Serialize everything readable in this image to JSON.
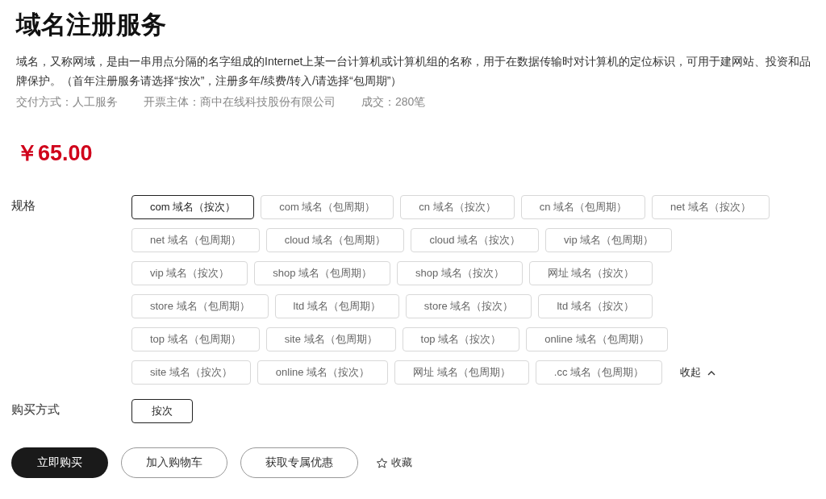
{
  "title": "域名注册服务",
  "description": "域名，又称网域，是由一串用点分隔的名字组成的Internet上某一台计算机或计算机组的名称，用于在数据传输时对计算机的定位标识，可用于建网站、投资和品牌保护。（首年注册服务请选择“按次”，注册多年/续费/转入/请选择“包周期”）",
  "meta": [
    "交付方式：人工服务",
    "开票主体：商中在线科技股份有限公司",
    "成交：280笔"
  ],
  "price": "￥65.00",
  "spec": {
    "label": "规格",
    "collapse_label": "收起",
    "rows": [
      [
        {
          "label": "com 域名（按次）",
          "selected": true
        },
        {
          "label": "com 域名（包周期）",
          "selected": false
        },
        {
          "label": "cn 域名（按次）",
          "selected": false
        },
        {
          "label": "cn 域名（包周期）",
          "selected": false
        },
        {
          "label": "net 域名（按次）",
          "selected": false
        }
      ],
      [
        {
          "label": "net 域名（包周期）",
          "selected": false
        },
        {
          "label": "cloud 域名（包周期）",
          "selected": false
        },
        {
          "label": "cloud 域名（按次）",
          "selected": false
        },
        {
          "label": "vip 域名（包周期）",
          "selected": false
        }
      ],
      [
        {
          "label": "vip 域名（按次）",
          "selected": false
        },
        {
          "label": "shop 域名（包周期）",
          "selected": false
        },
        {
          "label": "shop 域名（按次）",
          "selected": false
        },
        {
          "label": "网址 域名（按次）",
          "selected": false
        }
      ],
      [
        {
          "label": "store 域名（包周期）",
          "selected": false
        },
        {
          "label": "ltd 域名（包周期）",
          "selected": false
        },
        {
          "label": "store 域名（按次）",
          "selected": false
        },
        {
          "label": "ltd 域名（按次）",
          "selected": false
        }
      ],
      [
        {
          "label": "top 域名（包周期）",
          "selected": false
        },
        {
          "label": "site 域名（包周期）",
          "selected": false
        },
        {
          "label": "top 域名（按次）",
          "selected": false
        },
        {
          "label": "online 域名（包周期）",
          "selected": false
        }
      ],
      [
        {
          "label": "site 域名（按次）",
          "selected": false
        },
        {
          "label": "online 域名（按次）",
          "selected": false
        },
        {
          "label": "网址 域名（包周期）",
          "selected": false
        },
        {
          "label": ".cc 域名（包周期）",
          "selected": false
        }
      ]
    ]
  },
  "purchase": {
    "label": "购买方式",
    "options": [
      {
        "label": "按次",
        "selected": true
      }
    ]
  },
  "actions": [
    {
      "label": "立即购买",
      "kind": "primary"
    },
    {
      "label": "加入购物车",
      "kind": "outline"
    },
    {
      "label": "获取专属优惠",
      "kind": "outline"
    },
    {
      "label": "收藏",
      "kind": "favorite"
    }
  ]
}
